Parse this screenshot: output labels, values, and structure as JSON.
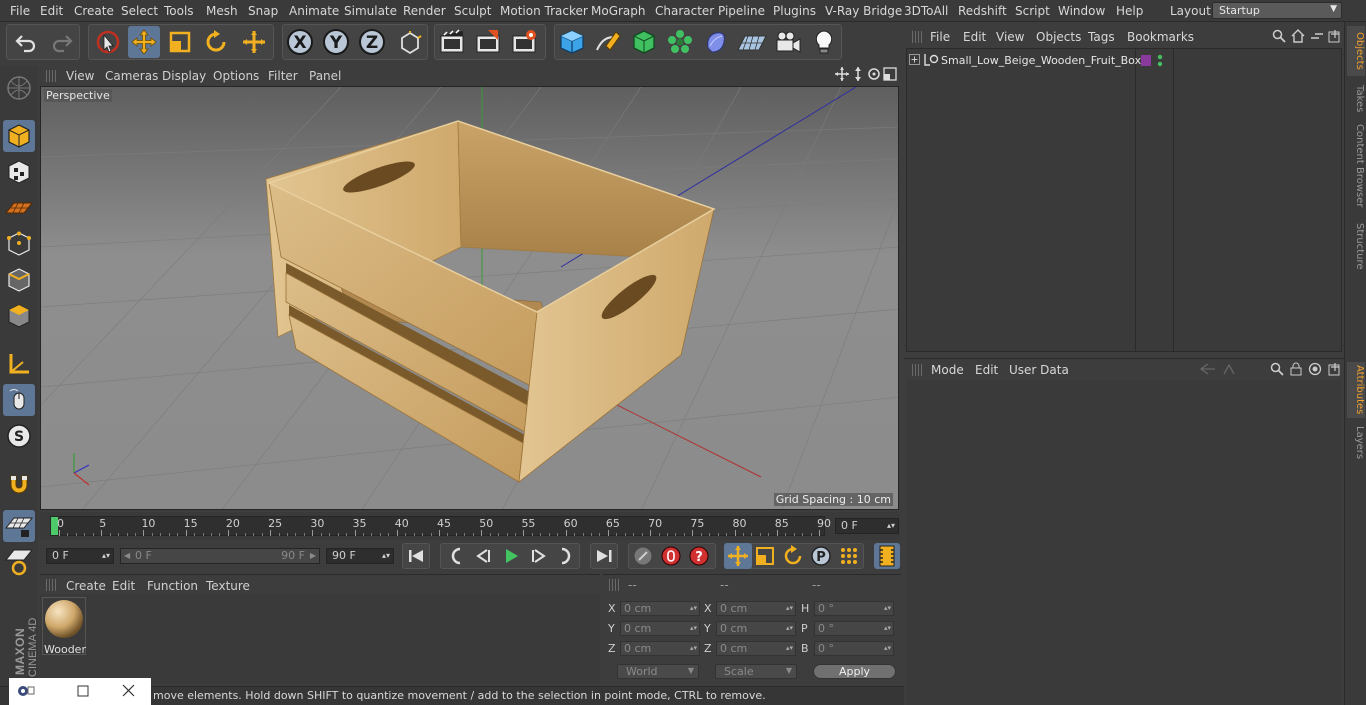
{
  "menubar": {
    "items": [
      "File",
      "Edit",
      "Create",
      "Select",
      "Tools",
      "Mesh",
      "Snap",
      "Animate",
      "Simulate",
      "Render",
      "Sculpt",
      "Motion Tracker",
      "MoGraph",
      "Character",
      "Pipeline",
      "Plugins",
      "V-Ray Bridge",
      "3DToAll",
      "Redshift",
      "Script",
      "Window",
      "Help"
    ],
    "layout_label": "Layout:",
    "layout_value": "Startup"
  },
  "toolbar": {
    "icons": [
      "undo-icon",
      "redo-icon",
      "live-selection-icon",
      "move-icon",
      "scale-icon",
      "rotate-icon",
      "recent-tool-icon",
      "x-axis-icon",
      "y-axis-icon",
      "z-axis-icon",
      "coordinate-system-icon",
      "render-view-icon",
      "render-picture-viewer-icon",
      "edit-render-settings-icon",
      "cube-icon",
      "pen-icon",
      "subdivision-icon",
      "cloner-icon",
      "deformer-icon",
      "floor-icon",
      "camera-icon",
      "light-icon"
    ],
    "axis_x": "X",
    "axis_y": "Y",
    "axis_z": "Z"
  },
  "viewport": {
    "menu": [
      "View",
      "Cameras",
      "Display",
      "Options",
      "Filter",
      "Panel"
    ],
    "label": "Perspective",
    "grid_spacing": "Grid Spacing : 10 cm"
  },
  "timeline": {
    "ticks": [
      "0",
      "5",
      "10",
      "15",
      "20",
      "25",
      "30",
      "35",
      "40",
      "45",
      "50",
      "55",
      "60",
      "65",
      "70",
      "75",
      "80",
      "85",
      "90"
    ],
    "current_frame": "0 F"
  },
  "controls": {
    "start_frame": "0 F",
    "range_start": "0 F",
    "range_end": "90 F",
    "end_frame": "90 F"
  },
  "material_manager": {
    "menu": [
      "Create",
      "Edit",
      "Function",
      "Texture"
    ],
    "materials": [
      {
        "name": "Wooden"
      }
    ]
  },
  "coordinates": {
    "headers": [
      "--",
      "--",
      "--"
    ],
    "rows": [
      {
        "a": "X",
        "av": "0 cm",
        "b": "X",
        "bv": "0 cm",
        "c": "H",
        "cv": "0 °"
      },
      {
        "a": "Y",
        "av": "0 cm",
        "b": "Y",
        "bv": "0 cm",
        "c": "P",
        "cv": "0 °"
      },
      {
        "a": "Z",
        "av": "0 cm",
        "b": "Z",
        "bv": "0 cm",
        "c": "B",
        "cv": "0 °"
      }
    ],
    "mode_world": "World",
    "mode_scale": "Scale",
    "apply": "Apply"
  },
  "status": {
    "text": "move elements. Hold down SHIFT to quantize movement / add to the selection in point mode, CTRL to remove."
  },
  "objects_manager": {
    "menu": [
      "File",
      "Edit",
      "View",
      "Objects",
      "Tags",
      "Bookmarks"
    ],
    "objects": [
      {
        "name": "Small_Low_Beige_Wooden_Fruit_Box"
      }
    ]
  },
  "attributes_manager": {
    "menu": [
      "Mode",
      "Edit",
      "User Data"
    ]
  },
  "side_tabs": {
    "top": [
      "Objects",
      "Takes",
      "Content Browser",
      "Structure"
    ],
    "bottom": [
      "Attributes",
      "Layers"
    ]
  },
  "branding": {
    "maxon": "MAXON",
    "cinema": "CINEMA 4D"
  },
  "colors": {
    "accent": "#5e7797",
    "selected_tab": "#f0a030",
    "wood": "#d4b07a"
  }
}
